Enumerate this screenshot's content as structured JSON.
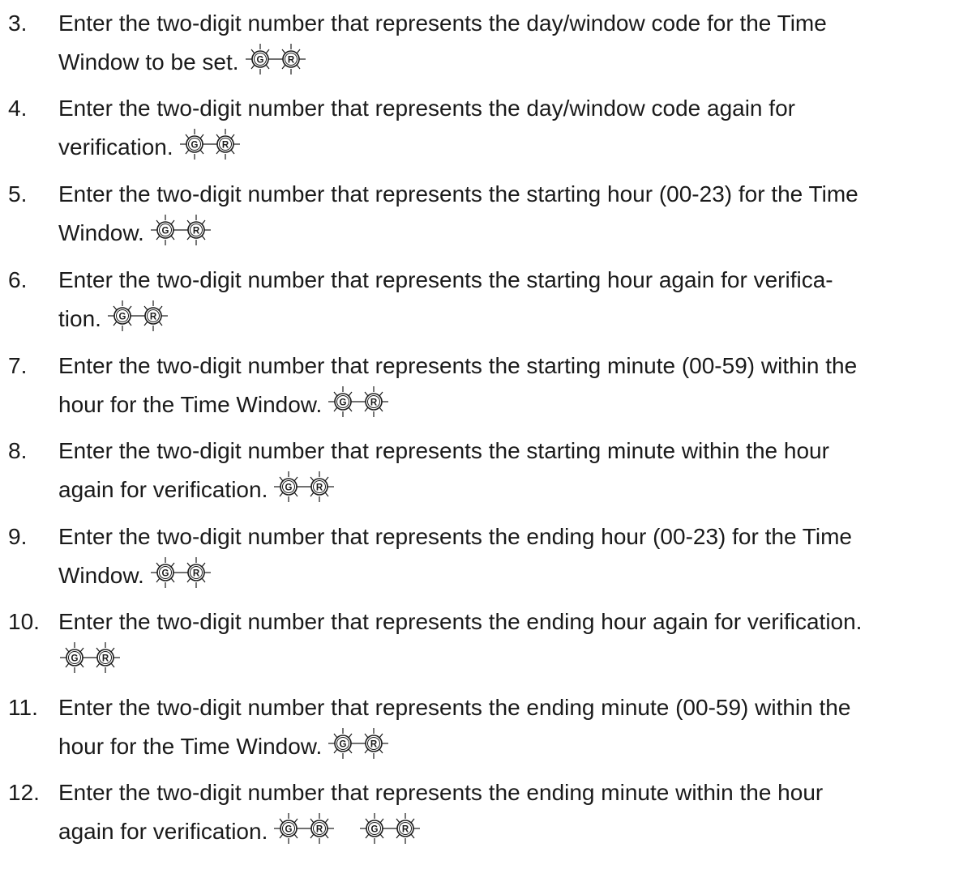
{
  "steps": [
    {
      "number": "3.",
      "text": "Enter the two-digit number that represents the day/window code for the Time Window to be set.",
      "lines": [
        "Enter the two-digit number that represents the day/window code for the Time",
        "Window to be set."
      ],
      "indicators": [
        {
          "green": "G",
          "red": "R"
        }
      ]
    },
    {
      "number": "4.",
      "lines": [
        "Enter the two-digit number that represents the day/window code again for",
        "verification."
      ],
      "indicators": [
        {
          "green": "G",
          "red": "R"
        }
      ]
    },
    {
      "number": "5.",
      "lines": [
        "Enter the two-digit number that represents the starting hour (00-23) for the Time",
        "Window."
      ],
      "indicators": [
        {
          "green": "G",
          "red": "R"
        }
      ]
    },
    {
      "number": "6.",
      "lines": [
        "Enter the two-digit number that represents the starting hour again for verifica-",
        "tion."
      ],
      "indicators": [
        {
          "green": "G",
          "red": "R"
        }
      ]
    },
    {
      "number": "7.",
      "lines": [
        "Enter the two-digit number that represents the starting minute (00-59) within the",
        "hour for the Time Window."
      ],
      "indicators": [
        {
          "green": "G",
          "red": "R"
        }
      ]
    },
    {
      "number": "8.",
      "lines": [
        "Enter the two-digit number that represents the starting minute within the hour",
        "again for verification."
      ],
      "indicators": [
        {
          "green": "G",
          "red": "R"
        }
      ]
    },
    {
      "number": "9.",
      "lines": [
        "Enter the two-digit number that represents the ending hour (00-23) for the Time",
        "Window."
      ],
      "indicators": [
        {
          "green": "G",
          "red": "R"
        }
      ]
    },
    {
      "number": "10.",
      "lines": [
        "Enter the two-digit number that represents the ending hour again for verification.",
        ""
      ],
      "indicators": [
        {
          "green": "G",
          "red": "R"
        }
      ]
    },
    {
      "number": "11.",
      "lines": [
        "Enter the two-digit number that represents the ending minute (00-59) within the",
        "hour for the Time Window."
      ],
      "indicators": [
        {
          "green": "G",
          "red": "R"
        }
      ]
    },
    {
      "number": "12.",
      "lines": [
        "Enter the two-digit number that represents the ending minute within the hour",
        "again for verification."
      ],
      "indicators": [
        {
          "green": "G",
          "red": "R"
        },
        {
          "green": "G",
          "red": "R"
        }
      ]
    }
  ]
}
